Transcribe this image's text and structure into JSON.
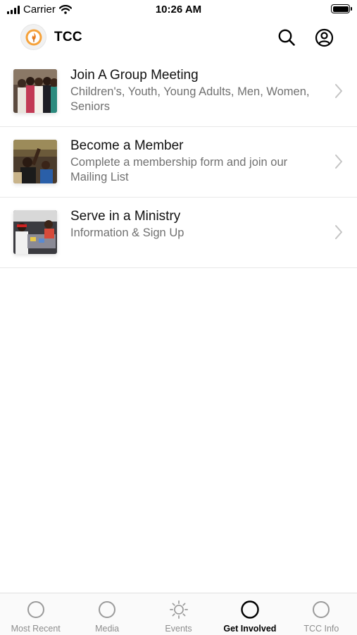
{
  "status_bar": {
    "carrier": "Carrier",
    "time": "10:26 AM"
  },
  "header": {
    "title": "TCC",
    "logo_icon": "church-flame-logo",
    "search_icon": "search-icon",
    "profile_icon": "user-circle-icon"
  },
  "list": {
    "items": [
      {
        "title": "Join A Group Meeting",
        "subtitle": "Children's, Youth, Young Adults, Men, Women, Seniors"
      },
      {
        "title": "Become a Member",
        "subtitle": "Complete a membership form and join our Mailing List"
      },
      {
        "title": "Serve in a Ministry",
        "subtitle": "Information & Sign Up"
      }
    ]
  },
  "tabbar": {
    "tabs": [
      {
        "label": "Most Recent",
        "icon": "circle-icon"
      },
      {
        "label": "Media",
        "icon": "circle-icon"
      },
      {
        "label": "Events",
        "icon": "sun-icon"
      },
      {
        "label": "Get Involved",
        "icon": "circle-icon",
        "active": true
      },
      {
        "label": "TCC Info",
        "icon": "circle-icon"
      }
    ]
  },
  "colors": {
    "accent": "#000000",
    "inactive": "#8e8e8e",
    "subtitle": "#707070",
    "logo_orange": "#e87b1c"
  }
}
